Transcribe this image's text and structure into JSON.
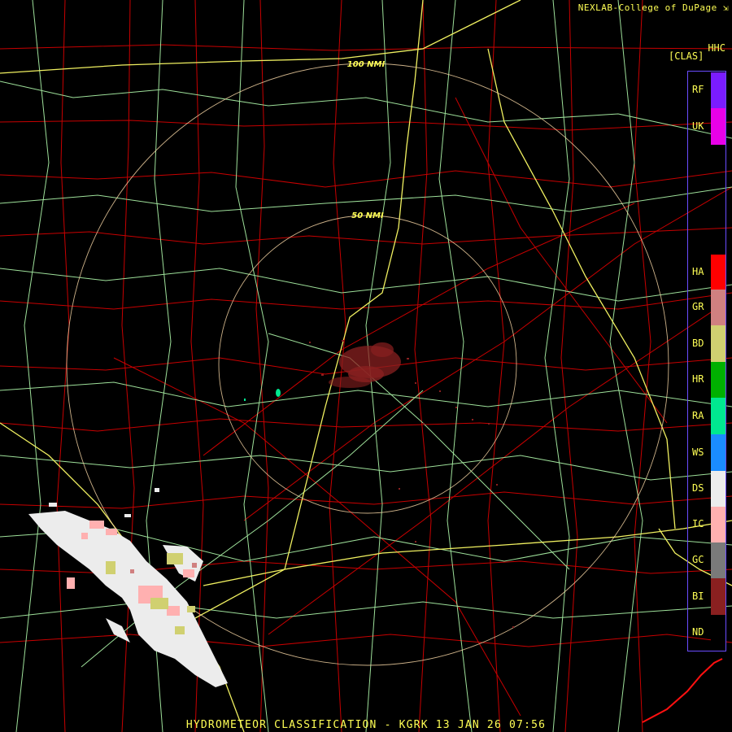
{
  "header": {
    "credit": "NEXLAB-College of DuPage",
    "credit_icon": "external-link-icon",
    "product_code": "HHC",
    "class_code": "[CLAS]"
  },
  "footer": {
    "title": "HYDROMETEOR CLASSIFICATION - KGRK 13 JAN 26 07:56"
  },
  "range_rings": [
    {
      "label": "50 NMI"
    },
    {
      "label": "100 NMI"
    }
  ],
  "legend": {
    "items": [
      {
        "code": "RF",
        "color": "#7a1cff"
      },
      {
        "code": "UK",
        "color": "#e800e8"
      },
      {
        "code": "HA",
        "color": "#ff0000"
      },
      {
        "code": "GR",
        "color": "#d08080"
      },
      {
        "code": "BD",
        "color": "#d0d070"
      },
      {
        "code": "HR",
        "color": "#00b000"
      },
      {
        "code": "RA",
        "color": "#00e890"
      },
      {
        "code": "WS",
        "color": "#1a8cff"
      },
      {
        "code": "DS",
        "color": "#ececec"
      },
      {
        "code": "IC",
        "color": "#ffb0b0"
      },
      {
        "code": "GC",
        "color": "#7a7a7a"
      },
      {
        "code": "BI",
        "color": "#8a2020"
      },
      {
        "code": "ND",
        "color": "#000000"
      }
    ]
  },
  "colors": {
    "county_lines": "#c80000",
    "highways": "#9ee09a",
    "interstates": "#f0f060",
    "range_rings": "#f0d0a0",
    "coastline": "#ff1010",
    "text": "#ffff55"
  }
}
